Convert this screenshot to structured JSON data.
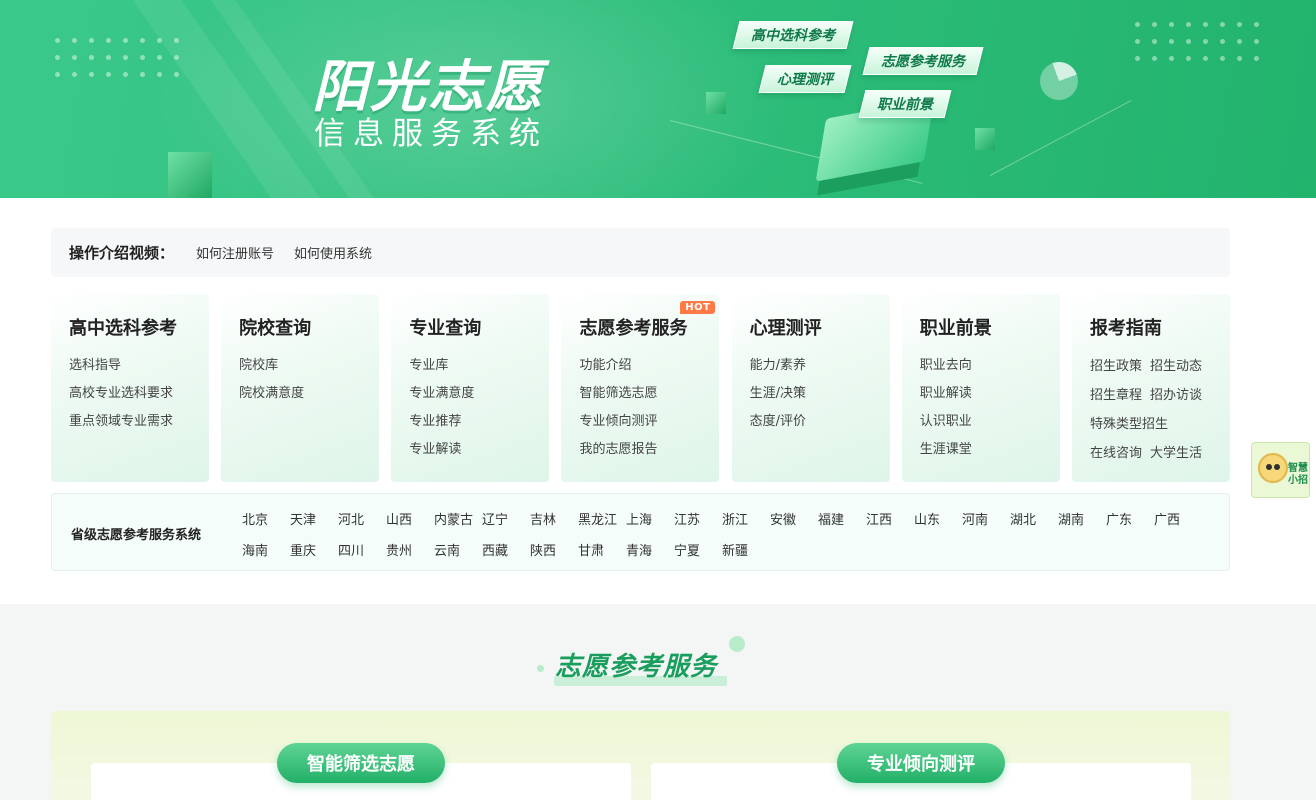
{
  "banner": {
    "title": "阳光志愿",
    "subtitle": "信息服务系统",
    "tags": [
      "高中选科参考",
      "志愿参考服务",
      "心理测评",
      "职业前景"
    ]
  },
  "intro": {
    "label": "操作介绍视频：",
    "links": [
      "如何注册账号",
      "如何使用系统"
    ]
  },
  "cards": [
    {
      "title": "高中选科参考",
      "items": [
        "选科指导",
        "高校专业选科要求",
        "重点领域专业需求"
      ]
    },
    {
      "title": "院校查询",
      "items": [
        "院校库",
        "院校满意度"
      ]
    },
    {
      "title": "专业查询",
      "items": [
        "专业库",
        "专业满意度",
        "专业推荐",
        "专业解读"
      ]
    },
    {
      "title": "志愿参考服务",
      "badge": "HOT",
      "items": [
        "功能介绍",
        "智能筛选志愿",
        "专业倾向测评",
        "我的志愿报告"
      ]
    },
    {
      "title": "心理测评",
      "items": [
        "能力/素养",
        "生涯/决策",
        "态度/评价"
      ]
    },
    {
      "title": "职业前景",
      "items": [
        "职业去向",
        "职业解读",
        "认识职业",
        "生涯课堂"
      ]
    },
    {
      "title": "报考指南",
      "rows": [
        [
          "招生政策",
          "招生动态"
        ],
        [
          "招生章程",
          "招办访谈"
        ],
        [
          "特殊类型招生"
        ],
        [
          "在线咨询",
          "大学生活"
        ]
      ]
    }
  ],
  "provinces": {
    "label": "省级志愿参考服务系统",
    "list": [
      "北京",
      "天津",
      "河北",
      "山西",
      "内蒙古",
      "辽宁",
      "吉林",
      "黑龙江",
      "上海",
      "江苏",
      "浙江",
      "安徽",
      "福建",
      "江西",
      "山东",
      "河南",
      "湖北",
      "湖南",
      "广东",
      "广西",
      "海南",
      "重庆",
      "四川",
      "贵州",
      "云南",
      "西藏",
      "陕西",
      "甘肃",
      "青海",
      "宁夏",
      "新疆"
    ]
  },
  "section": {
    "title": "志愿参考服务",
    "pills": [
      "智能筛选志愿",
      "专业倾向测评"
    ]
  },
  "assistant": {
    "label": "智慧小招"
  }
}
